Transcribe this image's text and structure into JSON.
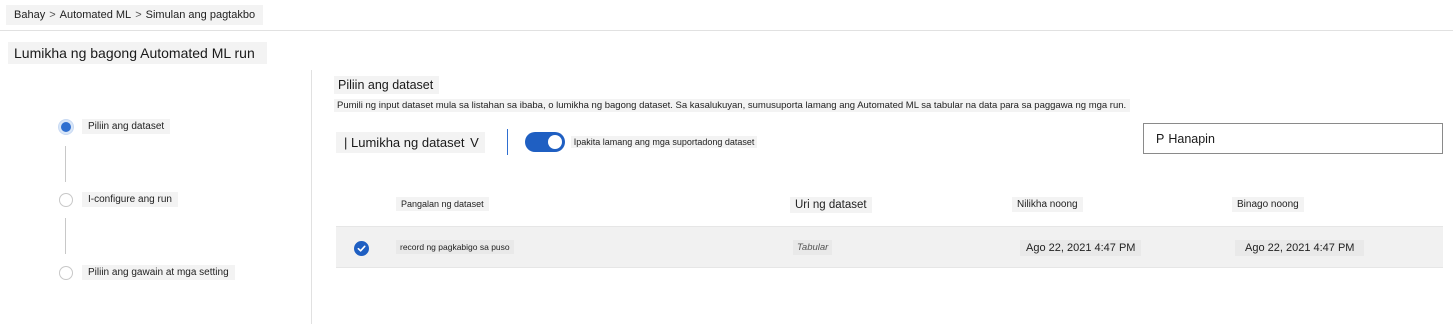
{
  "breadcrumb": {
    "items": [
      "Bahay",
      "Automated ML",
      "Simulan ang pagtakbo"
    ],
    "separator": ">"
  },
  "page": {
    "title": "Lumikha ng bagong Automated ML run"
  },
  "steps": [
    {
      "label": "Piliin ang dataset",
      "state": "active"
    },
    {
      "label": "I-configure ang run",
      "state": "pending"
    },
    {
      "label": "Piliin ang gawain at mga setting",
      "state": "pending"
    }
  ],
  "panel": {
    "title": "Piliin ang dataset",
    "description": "Pumili ng input dataset mula sa listahan sa ibaba, o lumikha ng bagong dataset. Sa kasalukuyan, sumusuporta lamang ang Automated ML sa tabular na data para sa paggawa ng mga run."
  },
  "toolbar": {
    "create_prefix": "|",
    "create_label": "Lumikha ng dataset",
    "create_caret": "V",
    "toggle_label": "Ipakita lamang ang mga suportadong dataset",
    "toggle_on": true
  },
  "search": {
    "icon": "P",
    "placeholder": "Hanapin"
  },
  "table": {
    "columns": [
      "Pangalan ng dataset",
      "Uri ng dataset",
      "Nilikha noong",
      "Binago noong"
    ],
    "rows": [
      {
        "selected": true,
        "name": "record ng pagkabigo sa puso",
        "type": "Tabular",
        "created": "Ago 22, 2021 4:47 PM",
        "modified": "Ago 22, 2021 4:47 PM"
      }
    ]
  },
  "colors": {
    "accent": "#1f5fc2",
    "active_step": "#2f6fd0",
    "row_bg": "#f1f1f1"
  }
}
